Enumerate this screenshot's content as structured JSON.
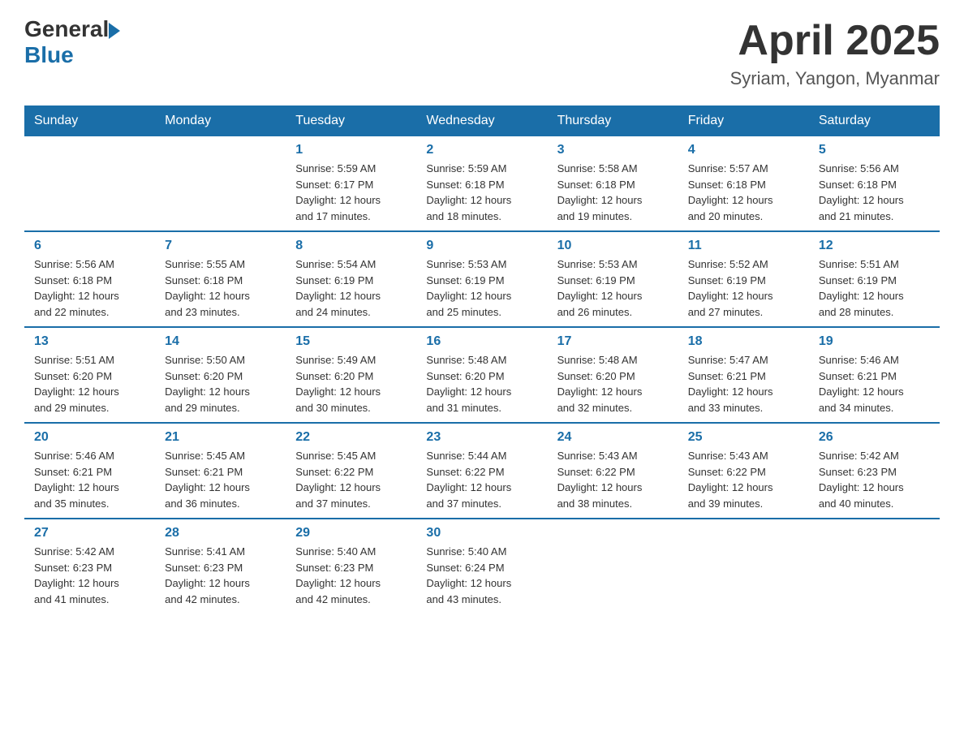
{
  "logo": {
    "general": "General",
    "blue": "Blue"
  },
  "title": "April 2025",
  "subtitle": "Syriam, Yangon, Myanmar",
  "headers": [
    "Sunday",
    "Monday",
    "Tuesday",
    "Wednesday",
    "Thursday",
    "Friday",
    "Saturday"
  ],
  "weeks": [
    [
      {
        "day": "",
        "info": ""
      },
      {
        "day": "",
        "info": ""
      },
      {
        "day": "1",
        "info": "Sunrise: 5:59 AM\nSunset: 6:17 PM\nDaylight: 12 hours\nand 17 minutes."
      },
      {
        "day": "2",
        "info": "Sunrise: 5:59 AM\nSunset: 6:18 PM\nDaylight: 12 hours\nand 18 minutes."
      },
      {
        "day": "3",
        "info": "Sunrise: 5:58 AM\nSunset: 6:18 PM\nDaylight: 12 hours\nand 19 minutes."
      },
      {
        "day": "4",
        "info": "Sunrise: 5:57 AM\nSunset: 6:18 PM\nDaylight: 12 hours\nand 20 minutes."
      },
      {
        "day": "5",
        "info": "Sunrise: 5:56 AM\nSunset: 6:18 PM\nDaylight: 12 hours\nand 21 minutes."
      }
    ],
    [
      {
        "day": "6",
        "info": "Sunrise: 5:56 AM\nSunset: 6:18 PM\nDaylight: 12 hours\nand 22 minutes."
      },
      {
        "day": "7",
        "info": "Sunrise: 5:55 AM\nSunset: 6:18 PM\nDaylight: 12 hours\nand 23 minutes."
      },
      {
        "day": "8",
        "info": "Sunrise: 5:54 AM\nSunset: 6:19 PM\nDaylight: 12 hours\nand 24 minutes."
      },
      {
        "day": "9",
        "info": "Sunrise: 5:53 AM\nSunset: 6:19 PM\nDaylight: 12 hours\nand 25 minutes."
      },
      {
        "day": "10",
        "info": "Sunrise: 5:53 AM\nSunset: 6:19 PM\nDaylight: 12 hours\nand 26 minutes."
      },
      {
        "day": "11",
        "info": "Sunrise: 5:52 AM\nSunset: 6:19 PM\nDaylight: 12 hours\nand 27 minutes."
      },
      {
        "day": "12",
        "info": "Sunrise: 5:51 AM\nSunset: 6:19 PM\nDaylight: 12 hours\nand 28 minutes."
      }
    ],
    [
      {
        "day": "13",
        "info": "Sunrise: 5:51 AM\nSunset: 6:20 PM\nDaylight: 12 hours\nand 29 minutes."
      },
      {
        "day": "14",
        "info": "Sunrise: 5:50 AM\nSunset: 6:20 PM\nDaylight: 12 hours\nand 29 minutes."
      },
      {
        "day": "15",
        "info": "Sunrise: 5:49 AM\nSunset: 6:20 PM\nDaylight: 12 hours\nand 30 minutes."
      },
      {
        "day": "16",
        "info": "Sunrise: 5:48 AM\nSunset: 6:20 PM\nDaylight: 12 hours\nand 31 minutes."
      },
      {
        "day": "17",
        "info": "Sunrise: 5:48 AM\nSunset: 6:20 PM\nDaylight: 12 hours\nand 32 minutes."
      },
      {
        "day": "18",
        "info": "Sunrise: 5:47 AM\nSunset: 6:21 PM\nDaylight: 12 hours\nand 33 minutes."
      },
      {
        "day": "19",
        "info": "Sunrise: 5:46 AM\nSunset: 6:21 PM\nDaylight: 12 hours\nand 34 minutes."
      }
    ],
    [
      {
        "day": "20",
        "info": "Sunrise: 5:46 AM\nSunset: 6:21 PM\nDaylight: 12 hours\nand 35 minutes."
      },
      {
        "day": "21",
        "info": "Sunrise: 5:45 AM\nSunset: 6:21 PM\nDaylight: 12 hours\nand 36 minutes."
      },
      {
        "day": "22",
        "info": "Sunrise: 5:45 AM\nSunset: 6:22 PM\nDaylight: 12 hours\nand 37 minutes."
      },
      {
        "day": "23",
        "info": "Sunrise: 5:44 AM\nSunset: 6:22 PM\nDaylight: 12 hours\nand 37 minutes."
      },
      {
        "day": "24",
        "info": "Sunrise: 5:43 AM\nSunset: 6:22 PM\nDaylight: 12 hours\nand 38 minutes."
      },
      {
        "day": "25",
        "info": "Sunrise: 5:43 AM\nSunset: 6:22 PM\nDaylight: 12 hours\nand 39 minutes."
      },
      {
        "day": "26",
        "info": "Sunrise: 5:42 AM\nSunset: 6:23 PM\nDaylight: 12 hours\nand 40 minutes."
      }
    ],
    [
      {
        "day": "27",
        "info": "Sunrise: 5:42 AM\nSunset: 6:23 PM\nDaylight: 12 hours\nand 41 minutes."
      },
      {
        "day": "28",
        "info": "Sunrise: 5:41 AM\nSunset: 6:23 PM\nDaylight: 12 hours\nand 42 minutes."
      },
      {
        "day": "29",
        "info": "Sunrise: 5:40 AM\nSunset: 6:23 PM\nDaylight: 12 hours\nand 42 minutes."
      },
      {
        "day": "30",
        "info": "Sunrise: 5:40 AM\nSunset: 6:24 PM\nDaylight: 12 hours\nand 43 minutes."
      },
      {
        "day": "",
        "info": ""
      },
      {
        "day": "",
        "info": ""
      },
      {
        "day": "",
        "info": ""
      }
    ]
  ]
}
